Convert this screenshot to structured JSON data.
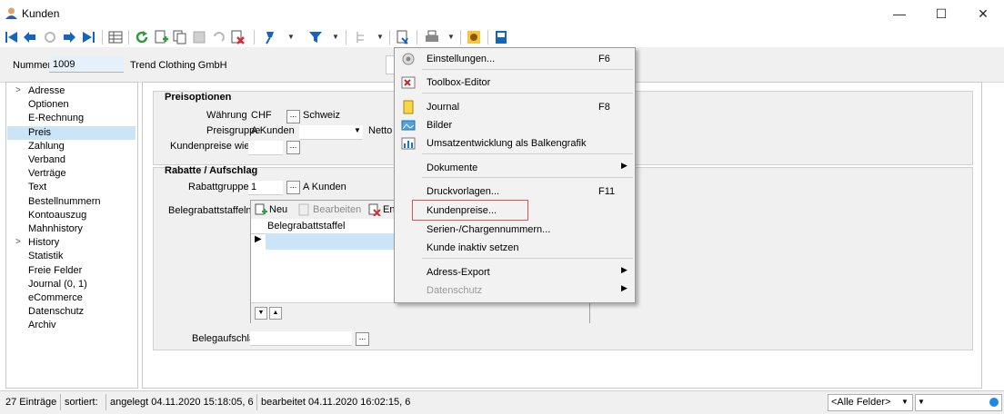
{
  "window": {
    "title": "Kunden",
    "minimize": "—",
    "maximize": "☐",
    "close": "✕"
  },
  "header": {
    "number_label": "Nummer",
    "number_value": "1009",
    "company_name": "Trend Clothing GmbH"
  },
  "nav": {
    "items": [
      {
        "label": "Adresse",
        "expandable": true
      },
      {
        "label": "Optionen"
      },
      {
        "label": "E-Rechnung"
      },
      {
        "label": "Preis",
        "selected": true
      },
      {
        "label": "Zahlung"
      },
      {
        "label": "Verband"
      },
      {
        "label": "Verträge"
      },
      {
        "label": "Text"
      },
      {
        "label": "Bestellnummern"
      },
      {
        "label": "Kontoauszug"
      },
      {
        "label": "Mahnhistory"
      },
      {
        "label": "History",
        "expandable": true
      },
      {
        "label": "Statistik"
      },
      {
        "label": "Freie Felder"
      },
      {
        "label": "Journal (0, 1)"
      },
      {
        "label": "eCommerce"
      },
      {
        "label": "Datenschutz"
      },
      {
        "label": "Archiv"
      }
    ]
  },
  "preisoptionen": {
    "title": "Preisoptionen",
    "waehrung_label": "Währung",
    "waehrung_value": "CHF",
    "waehrung_name": "Schweiz",
    "preisgruppe_label": "Preisgruppe",
    "preisgruppe_value": "A Kunden",
    "preisgruppe_extra": "Netto",
    "kundenpreise_label": "Kundenpreise wie"
  },
  "rabatte": {
    "title": "Rabatte / Aufschlag",
    "rabattgruppe_label": "Rabattgruppe",
    "rabattgruppe_value": "1",
    "rabattgruppe_name": "A Kunden",
    "belegrabatt_label": "Belegrabattstaffeln",
    "btn_neu": "Neu",
    "btn_bearbeiten": "Bearbeiten",
    "btn_entfernen": "En",
    "grid_header": "Belegrabattstaffel",
    "belegaufschlag_label": "Belegaufschlag"
  },
  "menu": {
    "items": [
      {
        "label": "Einstellungen...",
        "key": "F6"
      },
      {
        "label": "Toolbox-Editor"
      },
      {
        "label": "Journal",
        "key": "F8"
      },
      {
        "label": "Bilder"
      },
      {
        "label": "Umsatzentwicklung als Balkengrafik"
      },
      {
        "label": "Dokumente",
        "submenu": true
      },
      {
        "label": "Druckvorlagen...",
        "key": "F11"
      },
      {
        "label": "Kundenpreise..."
      },
      {
        "label": "Serien-/Chargennummern..."
      },
      {
        "label": "Kunde inaktiv setzen"
      },
      {
        "label": "Adress-Export",
        "submenu": true
      },
      {
        "label": "Datenschutz",
        "submenu": true,
        "disabled": true
      }
    ]
  },
  "status": {
    "count": "27 Einträge",
    "sorted": "sortiert:",
    "created": "angelegt 04.11.2020 15:18:05,  6",
    "edited": "bearbeitet 04.11.2020 16:02:15,  6",
    "filter_select": "<Alle Felder>"
  },
  "colors": {
    "selection": "#cce4f7",
    "highlight_box": "#d9534f",
    "toolbar_blue": "#1565c0"
  }
}
